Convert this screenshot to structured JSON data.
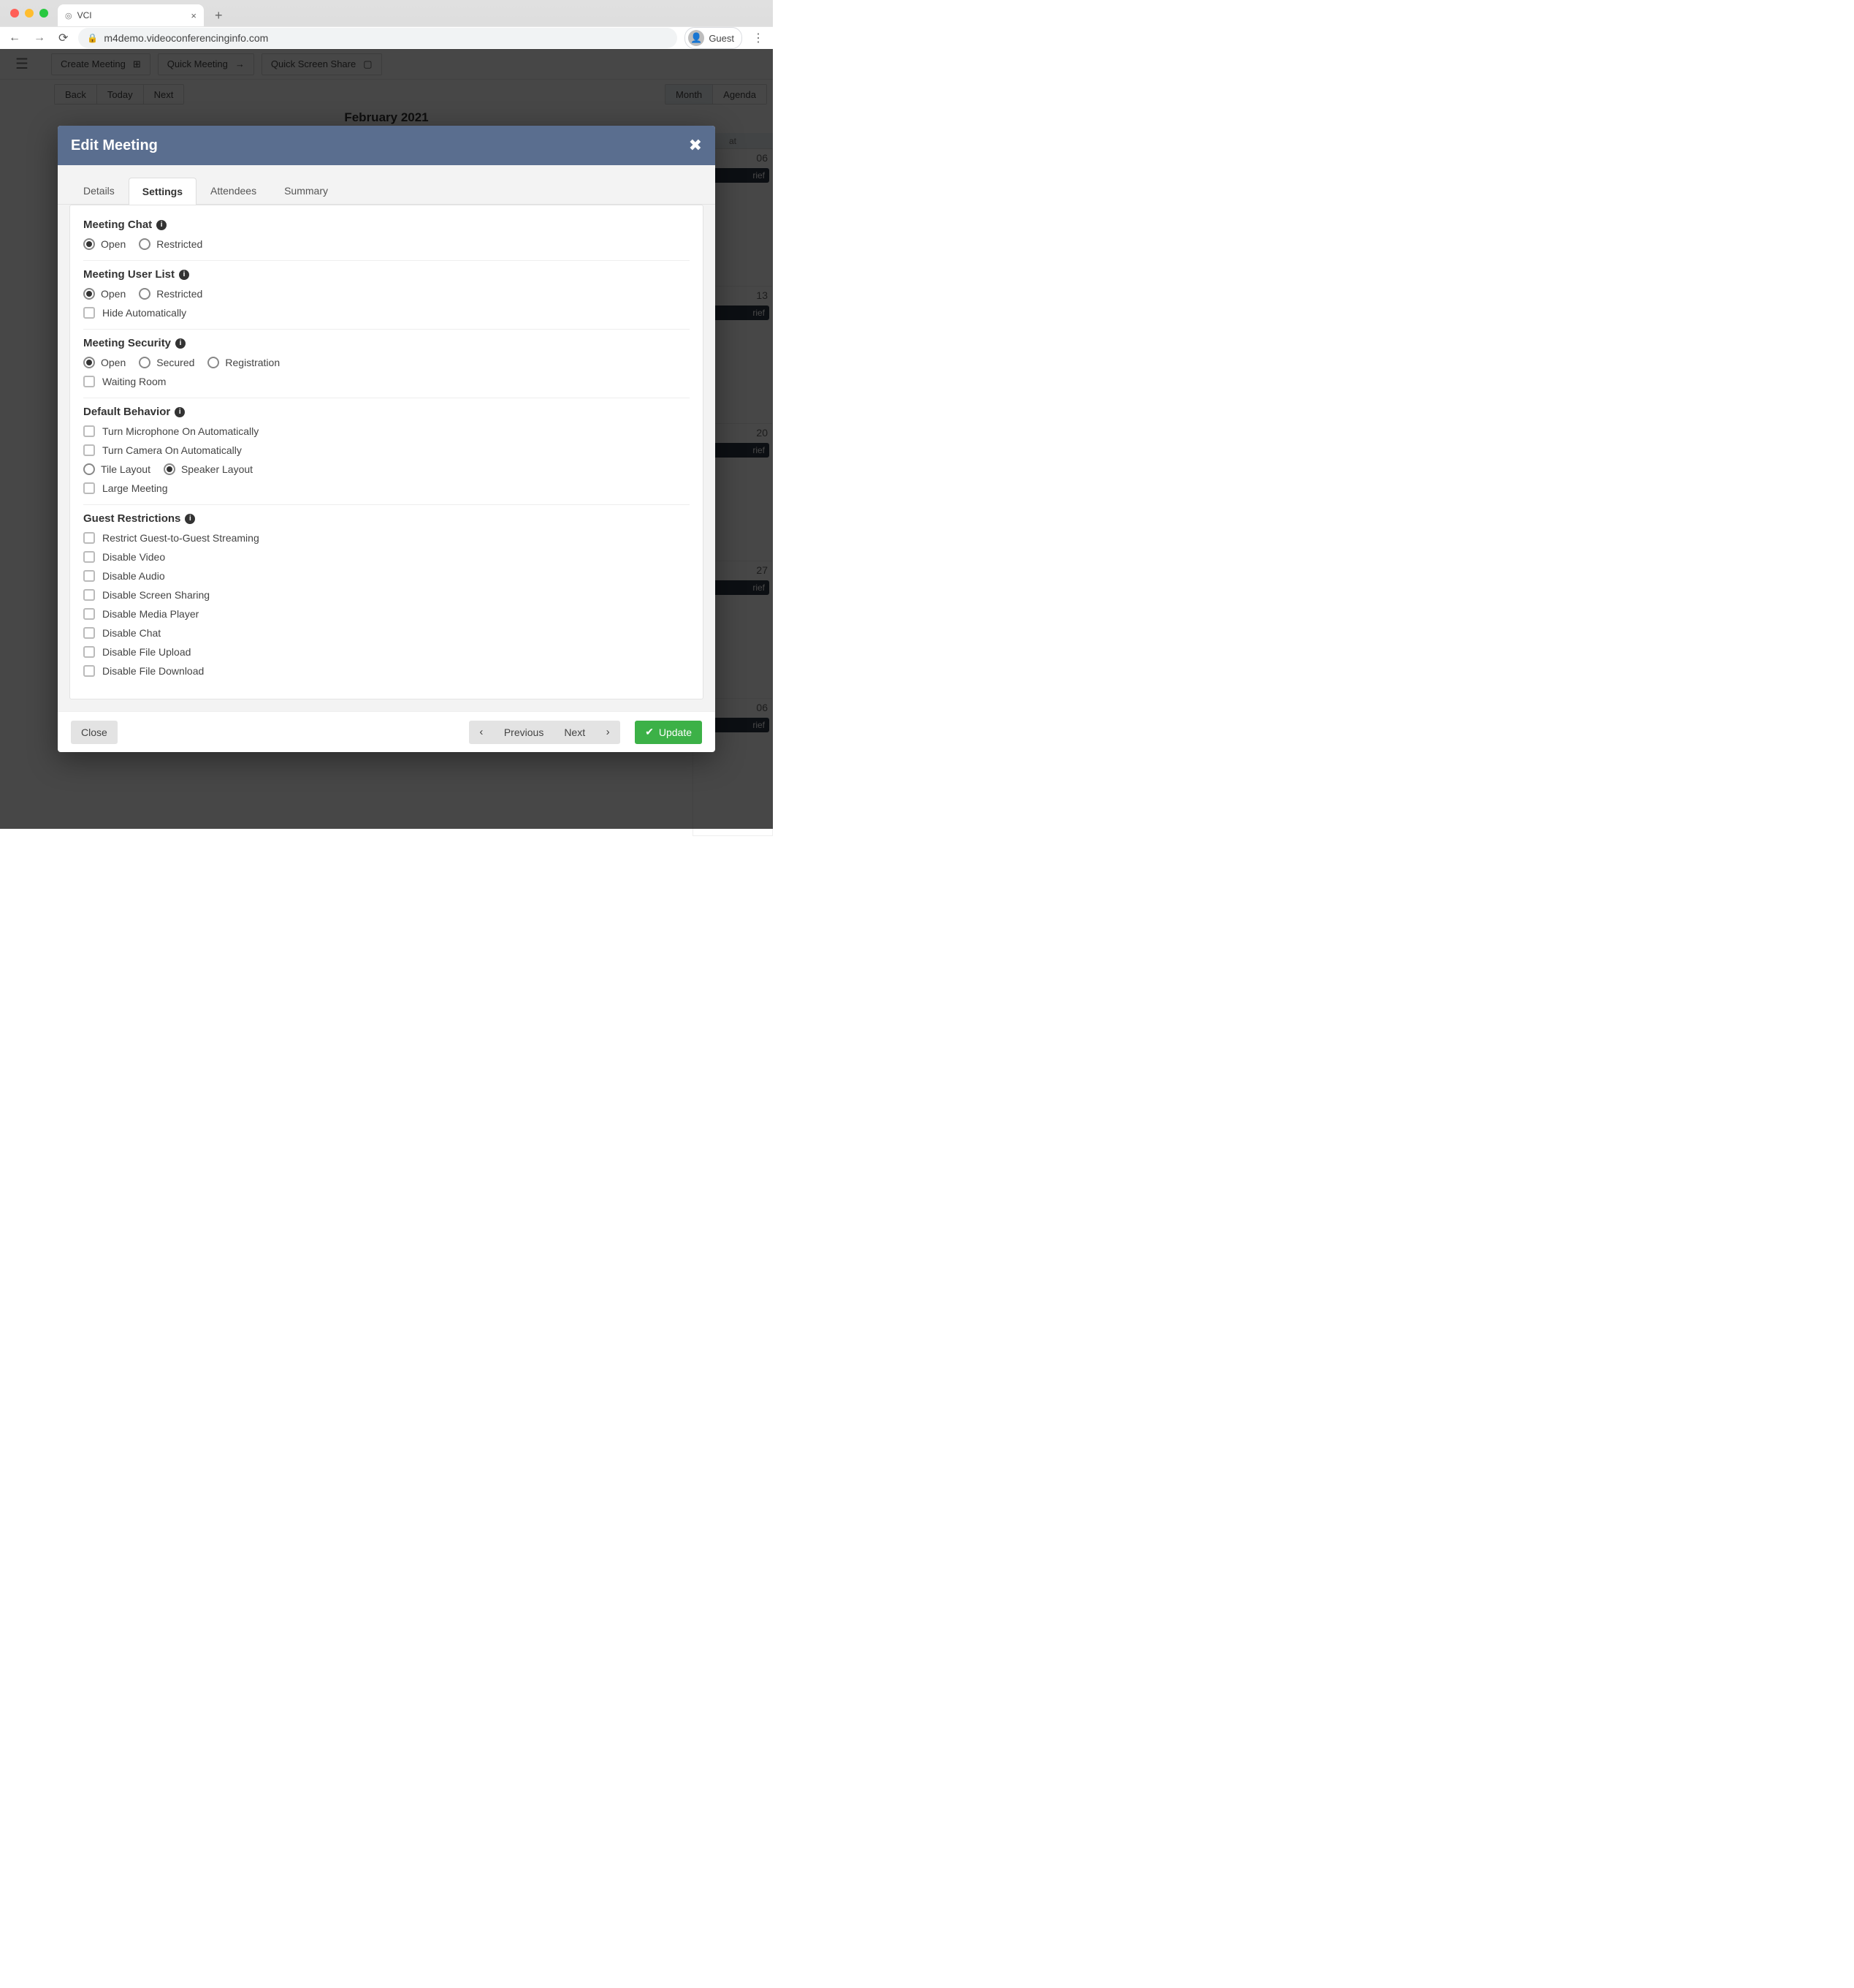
{
  "browser": {
    "tab_title": "VCI",
    "url": "m4demo.videoconferencinginfo.com",
    "guest_label": "Guest"
  },
  "toolbar": {
    "create_meeting": "Create Meeting",
    "quick_meeting": "Quick Meeting",
    "quick_screen_share": "Quick Screen Share"
  },
  "subtoolbar": {
    "back": "Back",
    "today": "Today",
    "next": "Next",
    "month": "Month",
    "agenda": "Agenda"
  },
  "calendar": {
    "title": "February 2021",
    "sat_header": "at",
    "days": [
      "06",
      "13",
      "20",
      "27",
      "06"
    ],
    "event_label": "rief"
  },
  "modal": {
    "title": "Edit Meeting",
    "tabs": [
      "Details",
      "Settings",
      "Attendees",
      "Summary"
    ],
    "active_tab": "Settings",
    "sections": {
      "meeting_chat": {
        "title": "Meeting Chat",
        "options": [
          "Open",
          "Restricted"
        ],
        "selected": "Open"
      },
      "meeting_user_list": {
        "title": "Meeting User List",
        "options": [
          "Open",
          "Restricted"
        ],
        "selected": "Open",
        "hide_auto": "Hide Automatically"
      },
      "meeting_security": {
        "title": "Meeting Security",
        "options": [
          "Open",
          "Secured",
          "Registration"
        ],
        "selected": "Open",
        "waiting_room": "Waiting Room"
      },
      "default_behavior": {
        "title": "Default Behavior",
        "mic": "Turn Microphone On Automatically",
        "cam": "Turn Camera On Automatically",
        "layout_options": [
          "Tile Layout",
          "Speaker Layout"
        ],
        "layout_selected": "Speaker Layout",
        "large_meeting": "Large Meeting"
      },
      "guest_restrictions": {
        "title": "Guest Restrictions",
        "items": [
          "Restrict Guest-to-Guest Streaming",
          "Disable Video",
          "Disable Audio",
          "Disable Screen Sharing",
          "Disable Media Player",
          "Disable Chat",
          "Disable File Upload",
          "Disable File Download"
        ]
      }
    },
    "footer": {
      "close": "Close",
      "previous": "Previous",
      "next": "Next",
      "update": "Update"
    }
  }
}
